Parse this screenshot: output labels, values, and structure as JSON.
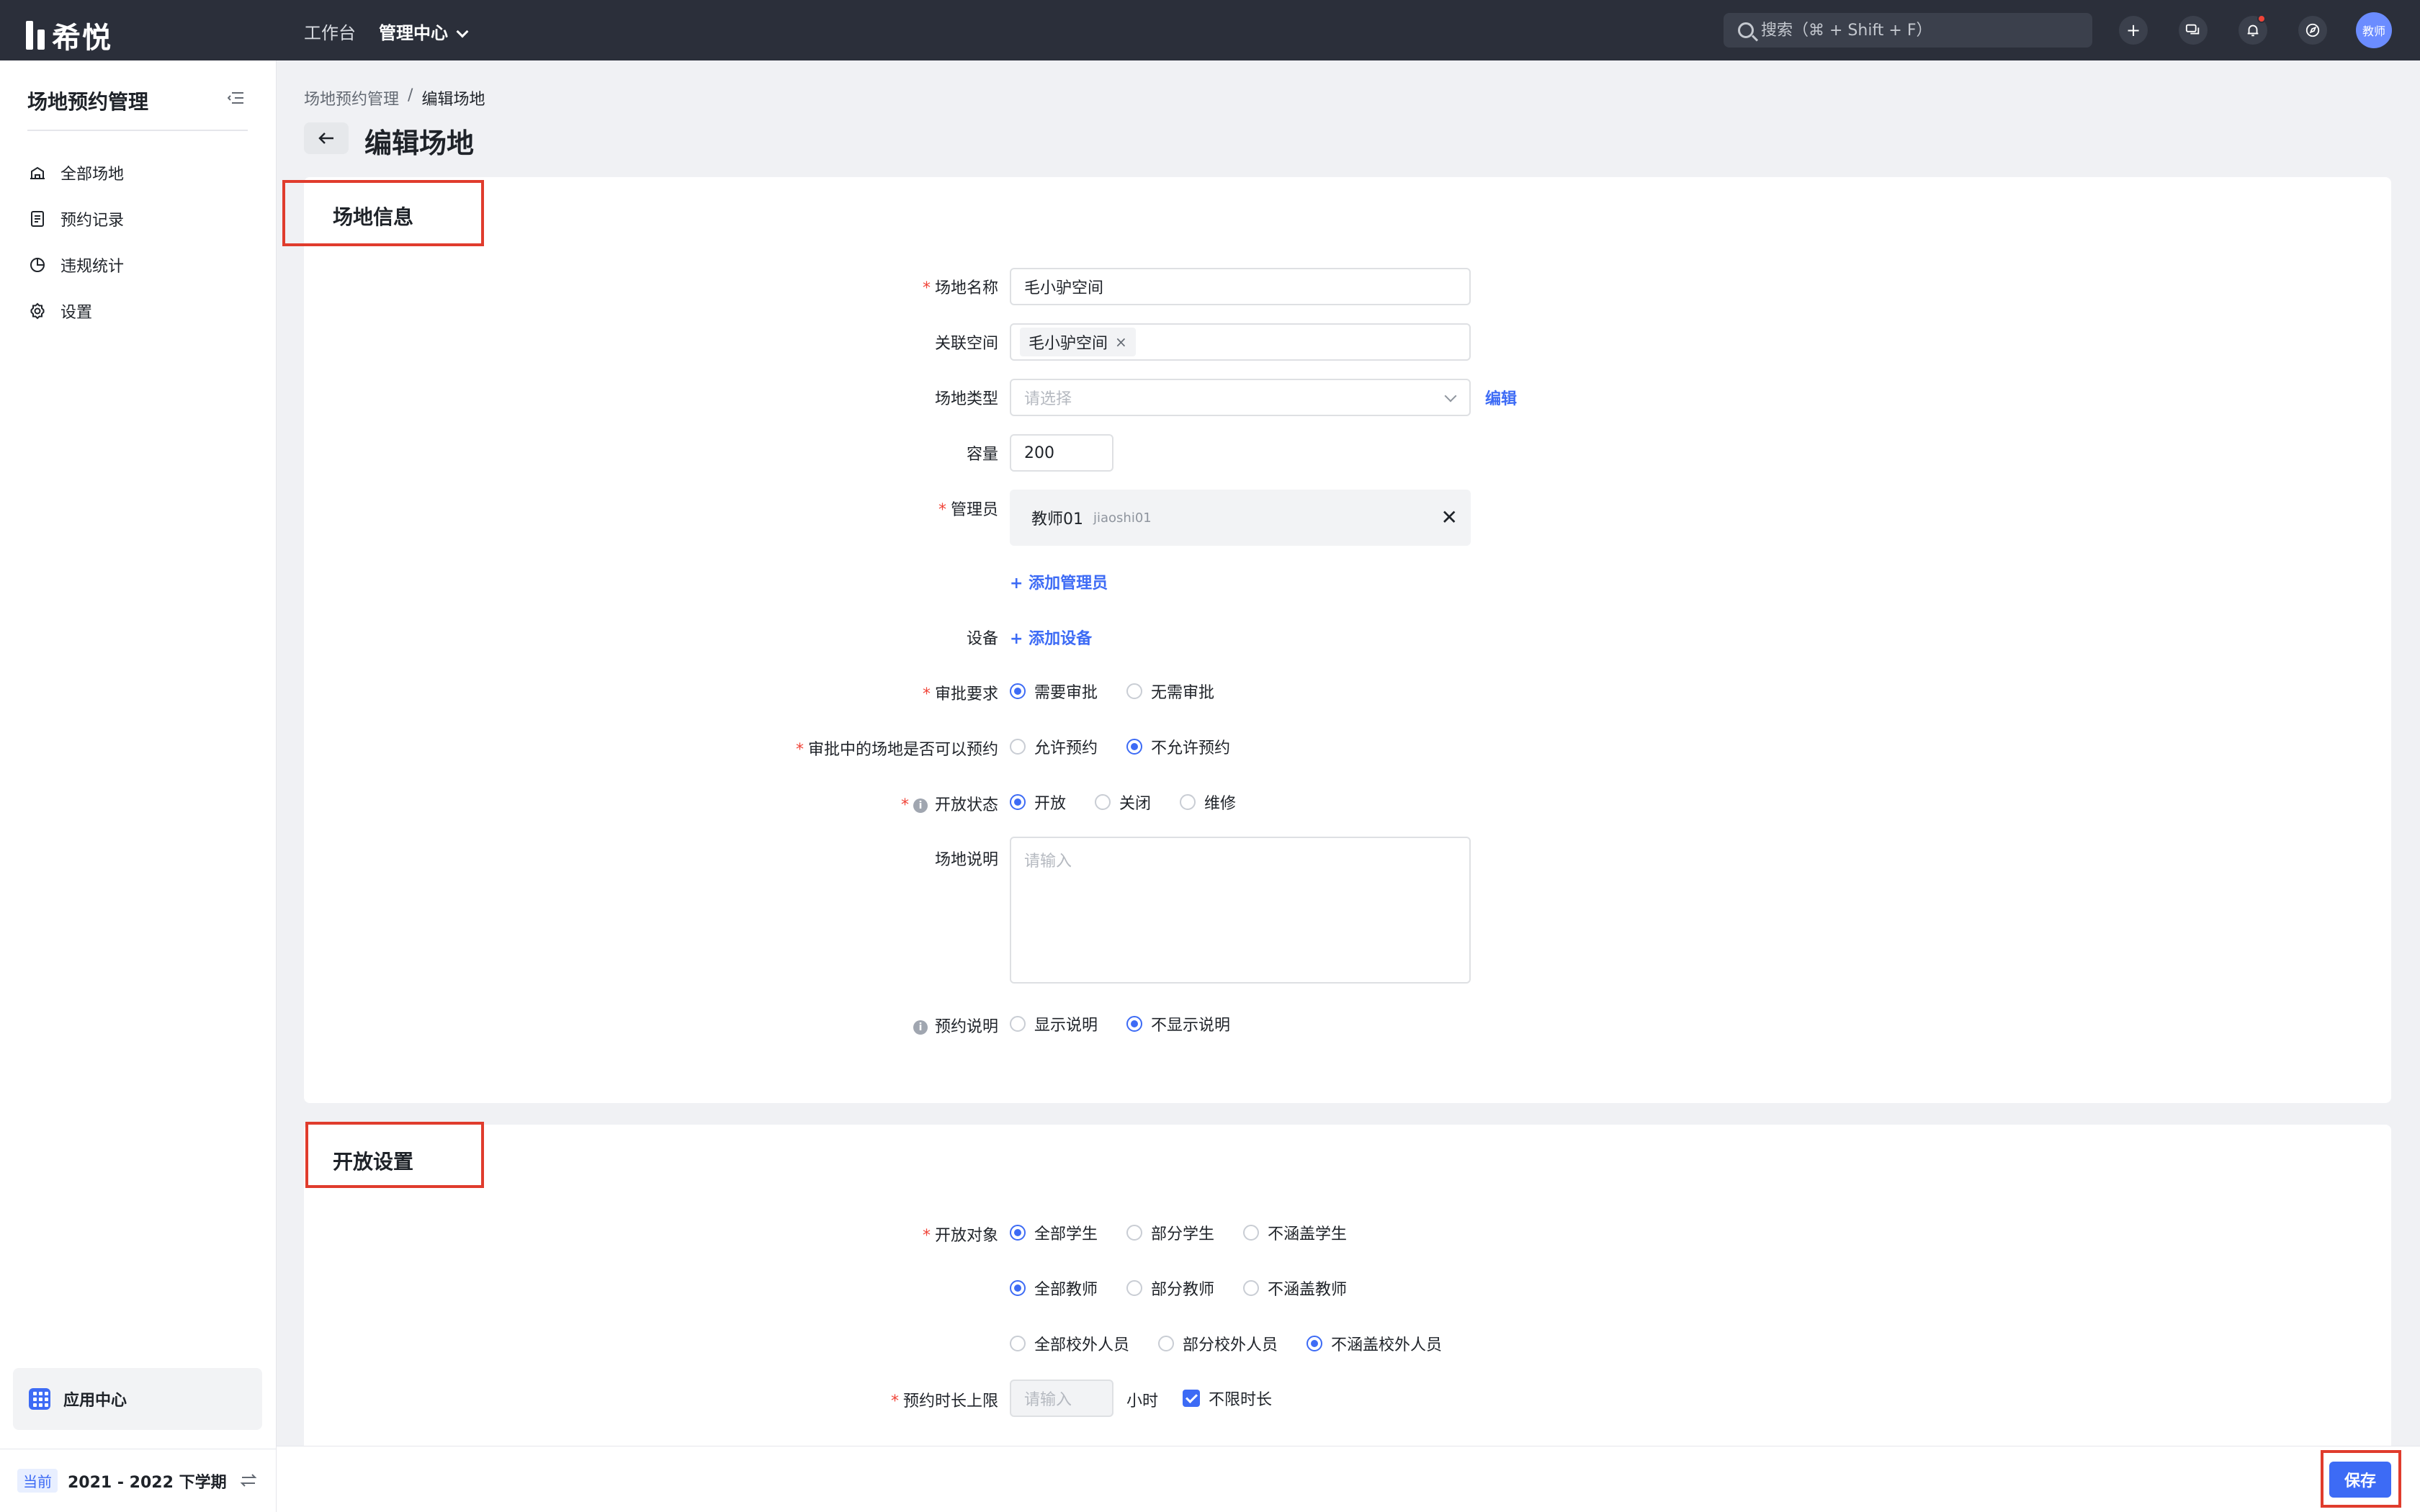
{
  "topbar": {
    "logo": "希悦",
    "nav": [
      {
        "label": "工作台"
      },
      {
        "label": "管理中心"
      }
    ],
    "search_placeholder": "搜索（⌘ + Shift + F）",
    "avatar": "教师"
  },
  "sidebar": {
    "title": "场地预约管理",
    "items": [
      {
        "label": "全部场地",
        "icon": "building-icon"
      },
      {
        "label": "预约记录",
        "icon": "document-icon"
      },
      {
        "label": "违规统计",
        "icon": "pie-chart-icon"
      },
      {
        "label": "设置",
        "icon": "gear-icon"
      }
    ],
    "app_center": "应用中心",
    "term_badge": "当前",
    "term": "2021 - 2022 下学期"
  },
  "breadcrumb": [
    "场地预约管理",
    "/",
    "编辑场地"
  ],
  "page_title": "编辑场地",
  "venue_info": {
    "section_title": "场地信息",
    "name": {
      "label": "场地名称",
      "value": "毛小驴空间"
    },
    "space": {
      "label": "关联空间",
      "tag": "毛小驴空间",
      "tag_close": "×"
    },
    "type": {
      "label": "场地类型",
      "placeholder": "请选择",
      "edit": "编辑"
    },
    "capacity": {
      "label": "容量",
      "value": "200"
    },
    "admin": {
      "label": "管理员",
      "name": "教师01",
      "id": "jiaoshi01",
      "close": "✕",
      "add": "+ 添加管理员"
    },
    "device": {
      "label": "设备",
      "add": "+ 添加设备"
    },
    "approval": {
      "label": "审批要求",
      "options": [
        "需要审批",
        "无需审批"
      ],
      "selected": 0
    },
    "pending_booking": {
      "label": "审批中的场地是否可以预约",
      "options": [
        "允许预约",
        "不允许预约"
      ],
      "selected": 1
    },
    "open_status": {
      "label": "开放状态",
      "options": [
        "开放",
        "关闭",
        "维修"
      ],
      "selected": 0
    },
    "description": {
      "label": "场地说明",
      "placeholder": "请输入"
    },
    "booking_note": {
      "label": "预约说明",
      "options": [
        "显示说明",
        "不显示说明"
      ],
      "selected": 1
    }
  },
  "open_settings": {
    "section_title": "开放设置",
    "target": {
      "label": "开放对象"
    },
    "students": {
      "options": [
        "全部学生",
        "部分学生",
        "不涵盖学生"
      ],
      "selected": 0
    },
    "teachers": {
      "options": [
        "全部教师",
        "部分教师",
        "不涵盖教师"
      ],
      "selected": 0
    },
    "external": {
      "options": [
        "全部校外人员",
        "部分校外人员",
        "不涵盖校外人员"
      ],
      "selected": 2
    },
    "duration": {
      "label": "预约时长上限",
      "placeholder": "请输入",
      "unit": "小时",
      "unlimited": "不限时长"
    }
  },
  "footer": {
    "save": "保存"
  }
}
